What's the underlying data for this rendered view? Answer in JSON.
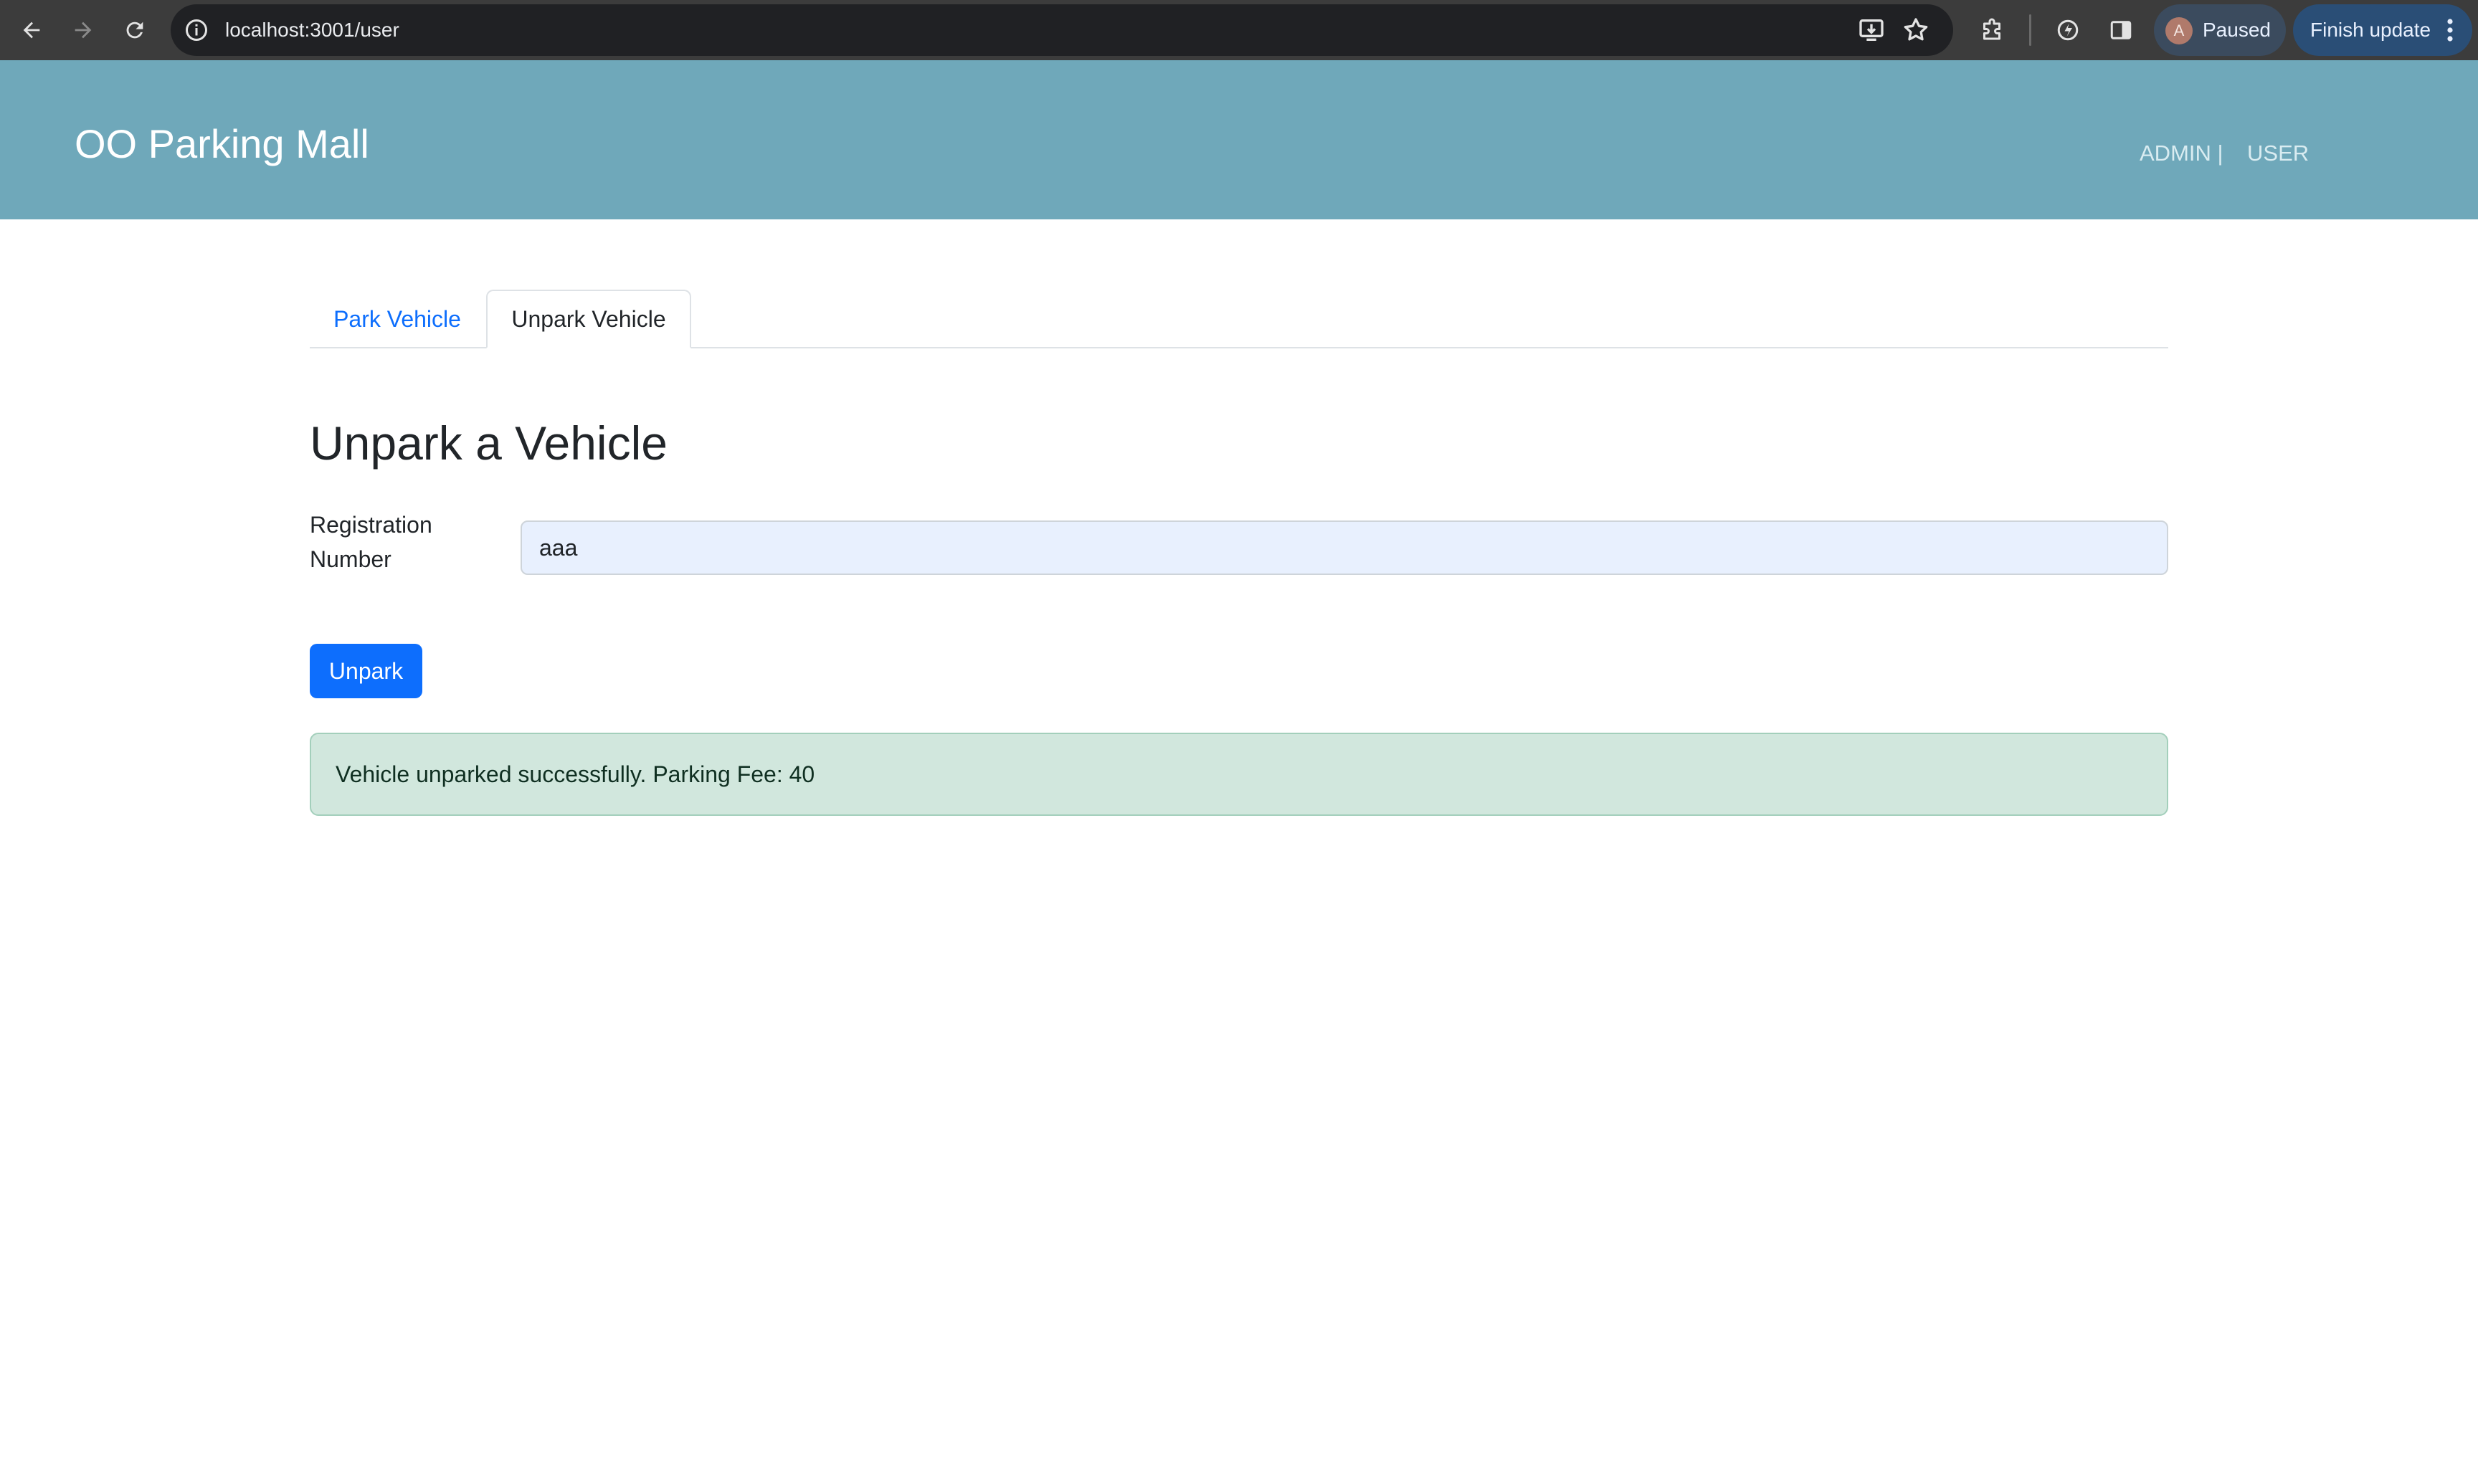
{
  "browser": {
    "url": "localhost:3001/user",
    "profile_initial": "A",
    "profile_status": "Paused",
    "update_label": "Finish update"
  },
  "header": {
    "brand": "OO Parking Mall",
    "nav_admin": "ADMIN |",
    "nav_user": "USER"
  },
  "tabs": [
    {
      "label": "Park Vehicle",
      "active": false
    },
    {
      "label": "Unpark Vehicle",
      "active": true
    }
  ],
  "form": {
    "title": "Unpark a Vehicle",
    "registration_label": "Registration Number",
    "registration_value": "aaa",
    "submit_label": "Unpark"
  },
  "alert": {
    "message": "Vehicle unparked successfully. Parking Fee: 40"
  },
  "colors": {
    "header_bg": "#6fa8ba",
    "primary": "#0d6efd",
    "success_bg": "#d1e7dd"
  }
}
